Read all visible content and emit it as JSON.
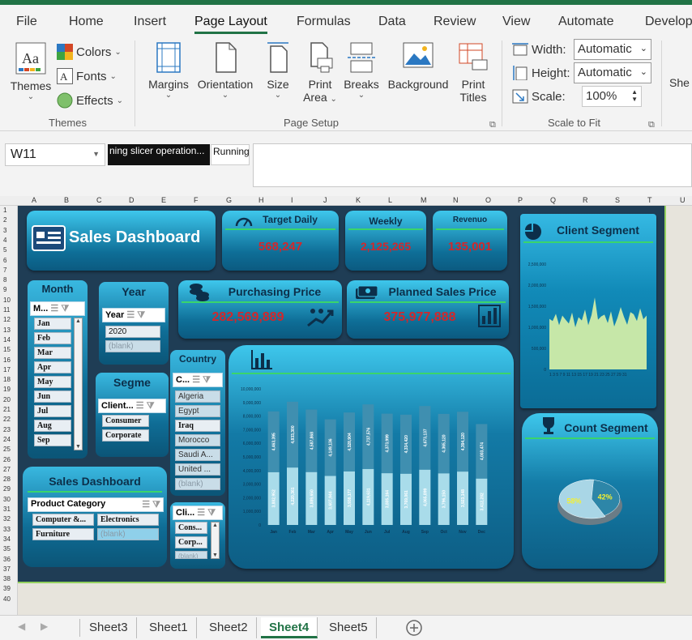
{
  "ribbon_tabs": [
    "File",
    "Home",
    "Insert",
    "Page Layout",
    "Formulas",
    "Data",
    "Review",
    "View",
    "Automate",
    "Develop"
  ],
  "themes_group": {
    "themes_label": "Themes",
    "colors_label": "Colors",
    "fonts_label": "Fonts",
    "effects_label": "Effects",
    "group_label": "Themes"
  },
  "page_setup": {
    "margins": "Margins",
    "orientation": "Orientation",
    "size": "Size",
    "print_area_1": "Print",
    "print_area_2": "Area",
    "breaks": "Breaks",
    "background": "Background",
    "print_titles_1": "Print",
    "print_titles_2": "Titles",
    "group_label": "Page Setup"
  },
  "scale_to_fit": {
    "width_label": "Width:",
    "width_value": "Automatic",
    "height_label": "Height:",
    "height_value": "Automatic",
    "scale_label": "Scale:",
    "scale_value": "100%",
    "group_label": "Scale to Fit"
  },
  "sheet_options_cut": "She",
  "formula_bar": {
    "name_box": "W11",
    "tip1": "ning slicer operation...",
    "tip2": "Running"
  },
  "column_headers": [
    "A",
    "B",
    "C",
    "D",
    "E",
    "F",
    "G",
    "H",
    "I",
    "J",
    "K",
    "L",
    "M",
    "N",
    "O",
    "P",
    "Q",
    "R",
    "S",
    "T",
    "U"
  ],
  "row_headers": [
    "1",
    "2",
    "3",
    "4",
    "5",
    "6",
    "7",
    "8",
    "9",
    "10",
    "11",
    "12",
    "13",
    "14",
    "15",
    "16",
    "17",
    "18",
    "19",
    "20",
    "21",
    "22",
    "23",
    "24",
    "25",
    "26",
    "27",
    "28",
    "29",
    "30",
    "31",
    "32",
    "33",
    "34",
    "35",
    "36",
    "37",
    "38",
    "39",
    "40"
  ],
  "dashboard": {
    "title": "Sales Dashboard",
    "kpis": [
      {
        "label": "Target Daily",
        "value": "568,247"
      },
      {
        "label": "Weekly",
        "value": "2,125,265"
      },
      {
        "label": "Revenuo",
        "value": "135,001"
      }
    ],
    "purchasing": {
      "label": "Purchasing Price",
      "value": "282,569,889"
    },
    "planned": {
      "label": "Planned Sales Price",
      "value": "375,977,888"
    },
    "month_slicer": {
      "title": "Month",
      "filter": "M...",
      "items": [
        "Jan",
        "Feb",
        "Mar",
        "Apr",
        "May",
        "Jun",
        "Jul",
        "Aug",
        "Sep"
      ]
    },
    "year_slicer": {
      "title": "Year",
      "filter": "Year",
      "items": [
        "2020",
        "(blank)"
      ]
    },
    "segment_slicer": {
      "title": "Segme",
      "filter": "Client...",
      "items": [
        "Consumer",
        "Corporate"
      ]
    },
    "country_slicer": {
      "title": "Country",
      "filter": "C...",
      "items": [
        "Algeria",
        "Egypt",
        "Iraq",
        "Morocco",
        "Saudi A...",
        "United ...",
        "(blank)"
      ]
    },
    "client_slicer": {
      "filter": "Cli...",
      "items": [
        "Cons...",
        "Corp...",
        "(blank)"
      ]
    },
    "product_slicer": {
      "title": "Sales Dashboard",
      "filter": "Product Category",
      "items": [
        "Computer &...",
        "Electronics",
        "Furniture",
        "(blank)"
      ]
    },
    "client_segment_title": "Client Segment",
    "count_segment_title": "Count Segment"
  },
  "chart_data": [
    {
      "type": "bar",
      "categories": [
        "Jan",
        "Feb",
        "Mar",
        "Apr",
        "May",
        "Jun",
        "Jul",
        "Aug",
        "Sep",
        "Oct",
        "Nov",
        "Dec"
      ],
      "series": [
        {
          "values": [
            3882952,
            4220361,
            3889650,
            3607944,
            3938177,
            4119631,
            3805164,
            3769061,
            4065899,
            3796150,
            3923148,
            3412282
          ]
        },
        {
          "values": [
            4463395,
            4833300,
            4587868,
            4149136,
            4328904,
            4737576,
            4373999,
            4334420,
            4673137,
            4365120,
            4394120,
            4003474
          ]
        }
      ],
      "stacked": true,
      "ylim": [
        0,
        10000000
      ],
      "yticks": [
        "10,000,000",
        "9,000,000",
        "8,000,000",
        "7,000,000",
        "6,000,000",
        "5,000,000",
        "4,000,000",
        "3,000,000",
        "2,000,000",
        "1,000,000",
        "0"
      ],
      "series_colors": [
        "#a9dcea",
        "#3f8fb0"
      ],
      "point_labels": [
        [
          "3,882,952",
          "4,220,361",
          "3,889,650",
          "3,607,944",
          "3,938,177",
          "4,119,631",
          "3,805,164",
          "3,769,061",
          "4,065,899",
          "3,796,150",
          "3,923,148",
          "3,412,282"
        ],
        [
          "4,463,395",
          "4,833,300",
          "4,587,868",
          "4,149,136",
          "4,328,904",
          "4,737,576",
          "4,373,999",
          "4,334,420",
          "4,673,137",
          "4,365,120",
          "4,394,120",
          "4,003,474"
        ]
      ]
    },
    {
      "type": "area",
      "x": [
        1,
        2,
        3,
        4,
        5,
        6,
        7,
        8,
        9,
        10,
        11,
        12,
        13,
        14,
        15,
        16,
        17,
        18,
        19,
        20,
        21,
        22,
        23,
        24,
        25,
        26,
        27,
        28,
        29,
        30,
        31
      ],
      "values": [
        1200000,
        1150000,
        1320000,
        1050000,
        1280000,
        1180000,
        1090000,
        1350000,
        1000000,
        1240000,
        1160000,
        1420000,
        1050000,
        1290000,
        1710000,
        1180000,
        1260000,
        1300000,
        1100000,
        1380000,
        1020000,
        1220000,
        1480000,
        1250000,
        1060000,
        1360000,
        1310000,
        1150000,
        1450000,
        1190000,
        1280000
      ],
      "ylim": [
        0,
        2500000
      ],
      "yticks": [
        "2,500,000",
        "2,000,000",
        "1,500,000",
        "1,000,000",
        "500,000",
        "0"
      ],
      "xtick_labels": "1 3 5 7 9 11 13 15 17 19 21 23 25 27 29 31",
      "color": "#c6e7a8"
    },
    {
      "type": "pie",
      "values": [
        42,
        58
      ],
      "labels": [
        "42%",
        "58%"
      ],
      "colors": [
        "#2d86a8",
        "#a9d6e6"
      ]
    }
  ],
  "sheet_tabs": [
    "Sheet3",
    "Sheet1",
    "Sheet2",
    "Sheet4",
    "Sheet5"
  ],
  "active_sheet": "Sheet4"
}
